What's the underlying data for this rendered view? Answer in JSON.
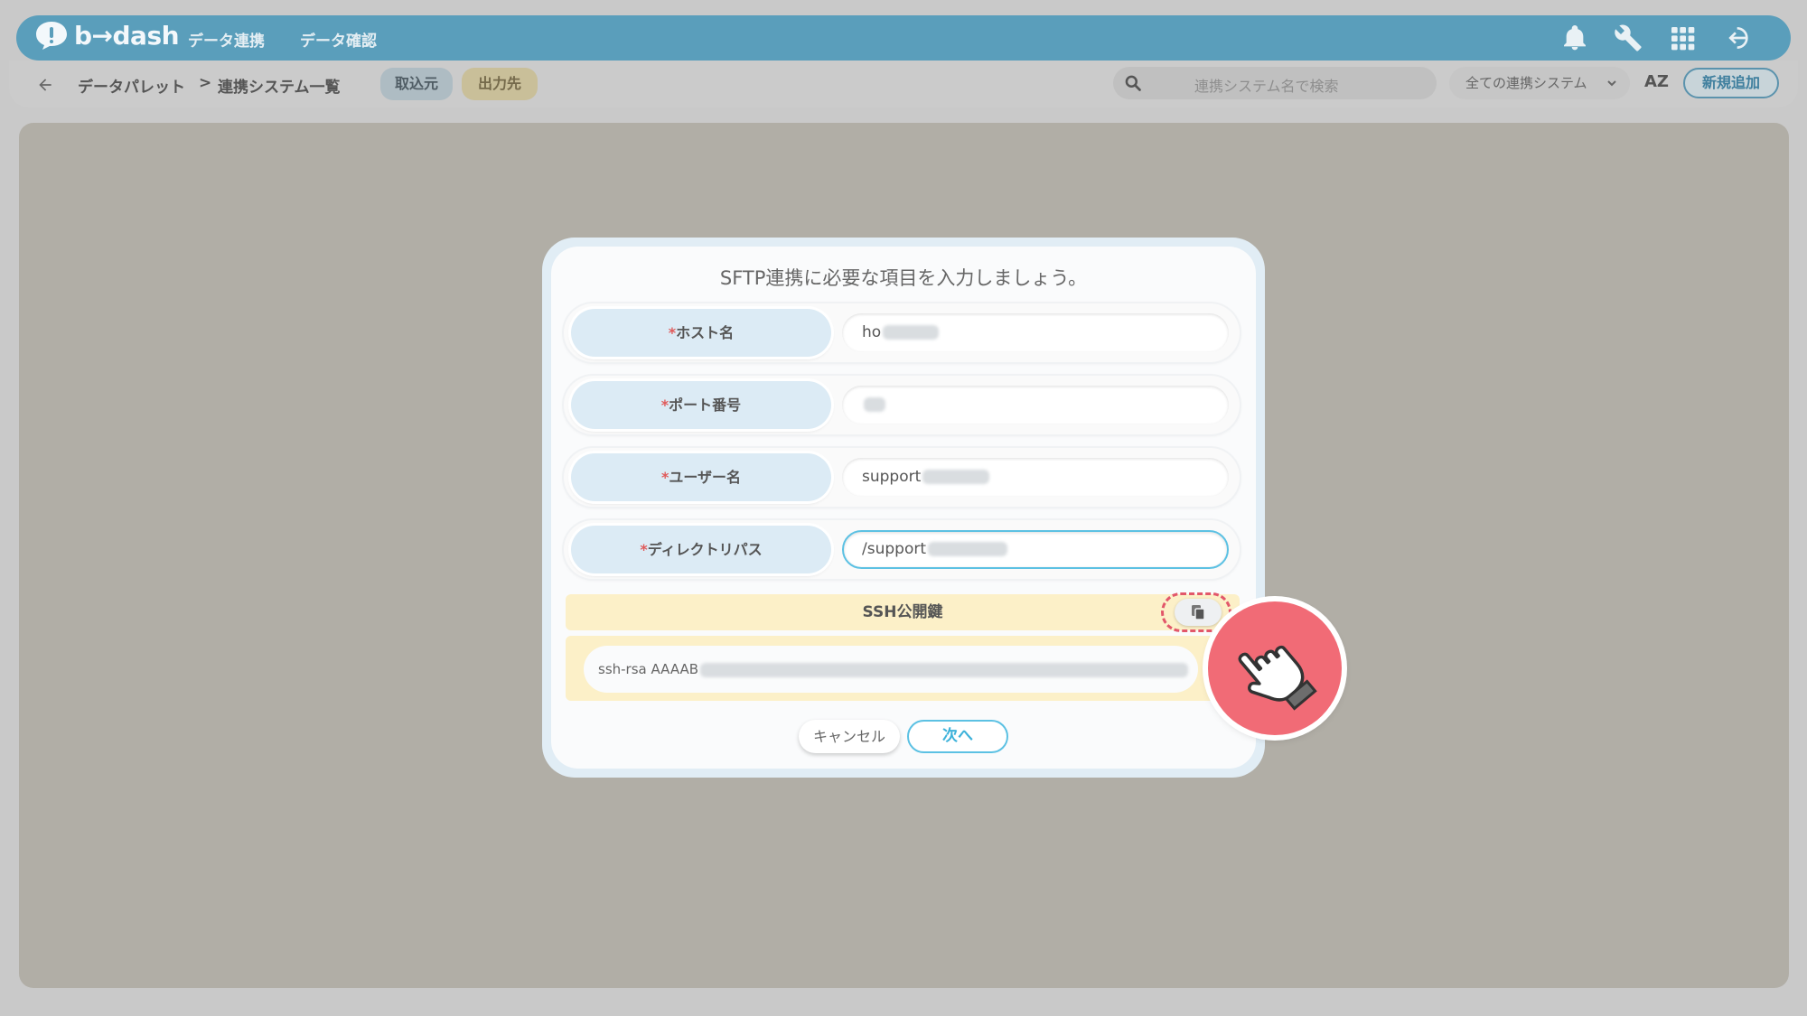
{
  "app": {
    "logo": "b→dash",
    "nav": [
      "データ連携",
      "データ確認"
    ]
  },
  "subbar": {
    "breadcrumb": [
      "データパレット",
      "連携システム一覧"
    ],
    "separator": ">",
    "tabs": {
      "import": "取込元",
      "export": "出力先"
    },
    "search_placeholder": "連携システム名で検索",
    "filter_selected": "全ての連携システム",
    "sort_label": "AZ",
    "new_button": "新規追加"
  },
  "modal": {
    "title": "SFTP連携に必要な項目を入力しましょう。",
    "required_mark": "*",
    "fields": [
      {
        "label": "ホスト名",
        "value": "ho"
      },
      {
        "label": "ポート番号",
        "value": ""
      },
      {
        "label": "ユーザー名",
        "value": "support"
      },
      {
        "label": "ディレクトリパス",
        "value": "/support"
      }
    ],
    "ssh": {
      "header": "SSH公開鍵",
      "value": "ssh-rsa AAAAB"
    },
    "buttons": {
      "cancel": "キャンセル",
      "next": "次へ"
    }
  },
  "colors": {
    "header": "#5a9ebb",
    "accent": "#5cc1e3",
    "required": "#e05a5a",
    "highlight": "#f16b76"
  },
  "icons": [
    "back-arrow-icon",
    "bell-icon",
    "wrench-icon",
    "apps-grid-icon",
    "logout-icon",
    "search-icon",
    "chevron-down-icon",
    "copy-icon",
    "pointing-hand-icon"
  ]
}
